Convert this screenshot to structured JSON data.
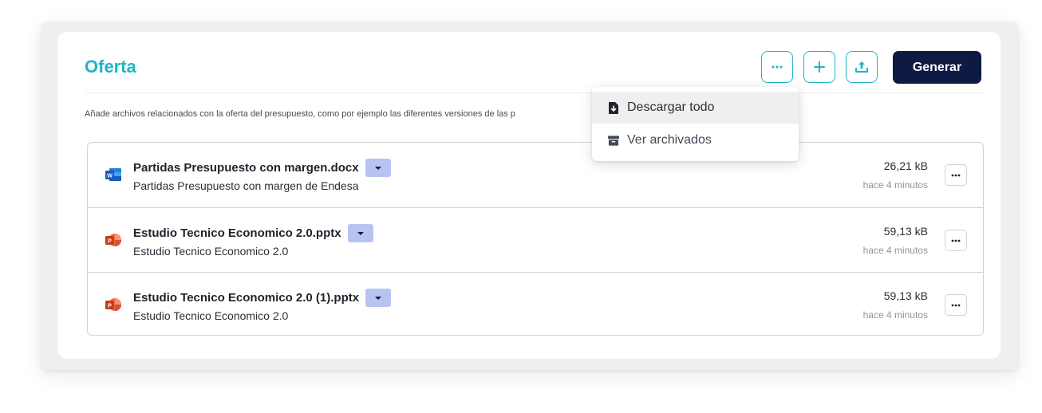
{
  "section": {
    "title": "Oferta",
    "description": "Añade archivos relacionados con la oferta del presupuesto, como por ejemplo las diferentes versiones de las p",
    "accent_color": "#1fb4c9"
  },
  "toolbar": {
    "more_icon": "ellipsis-icon",
    "add_icon": "plus-icon",
    "upload_icon": "upload-icon",
    "generate_label": "Generar",
    "generate_color": "#0d1a42"
  },
  "dropdown": {
    "items": [
      {
        "label": "Descargar todo",
        "icon": "file-download-icon"
      },
      {
        "label": "Ver archivados",
        "icon": "archive-icon"
      }
    ]
  },
  "files": [
    {
      "name": "Partidas Presupuesto con margen.docx",
      "description": "Partidas Presupuesto con margen de Endesa",
      "size": "26,21 kB",
      "time": "hace 4 minutos",
      "type": "word-icon"
    },
    {
      "name": "Estudio Tecnico Economico 2.0.pptx",
      "description": "Estudio Tecnico Economico 2.0",
      "size": "59,13 kB",
      "time": "hace 4 minutos",
      "type": "powerpoint-icon"
    },
    {
      "name": "Estudio Tecnico Economico 2.0 (1).pptx",
      "description": "Estudio Tecnico Economico 2.0",
      "size": "59,13 kB",
      "time": "hace 4 minutos",
      "type": "powerpoint-icon"
    }
  ]
}
